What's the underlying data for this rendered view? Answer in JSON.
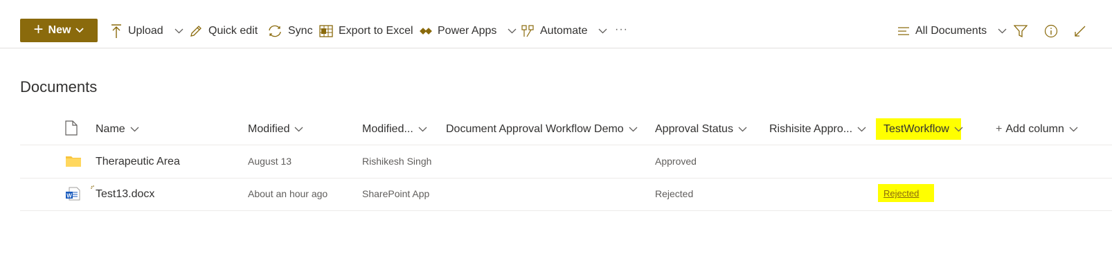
{
  "toolbar": {
    "new_label": "New",
    "upload_label": "Upload",
    "quick_edit_label": "Quick edit",
    "sync_label": "Sync",
    "export_label": "Export to Excel",
    "power_apps_label": "Power Apps",
    "automate_label": "Automate",
    "more_label": "···",
    "view_label": "All Documents"
  },
  "page": {
    "title": "Documents"
  },
  "columns": {
    "name": "Name",
    "modified": "Modified",
    "modified_by": "Modified...",
    "doc_approval": "Document Approval Workflow Demo",
    "approval_status": "Approval Status",
    "rishisite": "Rishisite Appro...",
    "test_workflow": "TestWorkflow",
    "add_column": "Add column"
  },
  "rows": [
    {
      "name": "Therapeutic Area",
      "modified": "August 13",
      "modified_by": "Rishikesh Singh",
      "approval_status": "Approved",
      "test_workflow": ""
    },
    {
      "name": "Test13.docx",
      "modified": "About an hour ago",
      "modified_by": "SharePoint App",
      "approval_status": "Rejected",
      "test_workflow": "Rejected"
    }
  ],
  "colors": {
    "accent": "#8a6a0c",
    "highlight": "#ffff00",
    "folder": "#f8c43d",
    "word": "#185abd"
  }
}
